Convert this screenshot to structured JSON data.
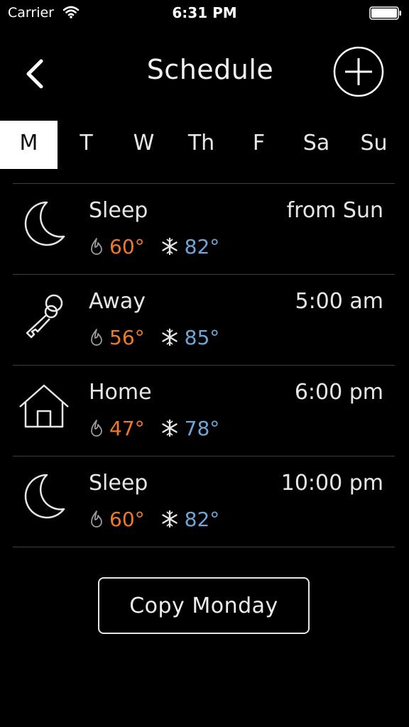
{
  "status_bar": {
    "carrier": "Carrier",
    "time": "6:31 PM"
  },
  "header": {
    "title": "Schedule",
    "back_icon": "chevron-left-icon",
    "add_icon": "plus-circle-icon"
  },
  "days": [
    {
      "label": "M",
      "active": true
    },
    {
      "label": "T",
      "active": false
    },
    {
      "label": "W",
      "active": false
    },
    {
      "label": "Th",
      "active": false
    },
    {
      "label": "F",
      "active": false
    },
    {
      "label": "Sa",
      "active": false
    },
    {
      "label": "Su",
      "active": false
    }
  ],
  "schedule": [
    {
      "icon": "moon-icon",
      "name": "Sleep",
      "time": "from Sun",
      "heat": "60°",
      "cool": "82°"
    },
    {
      "icon": "key-icon",
      "name": "Away",
      "time": "5:00 am",
      "heat": "56°",
      "cool": "85°"
    },
    {
      "icon": "house-icon",
      "name": "Home",
      "time": "6:00 pm",
      "heat": "47°",
      "cool": "78°"
    },
    {
      "icon": "moon-icon",
      "name": "Sleep",
      "time": "10:00 pm",
      "heat": "60°",
      "cool": "82°"
    }
  ],
  "copy_button_label": "Copy Monday",
  "colors": {
    "heat": "#ec7a2a",
    "cool": "#6ea6d8",
    "background": "#000000"
  }
}
